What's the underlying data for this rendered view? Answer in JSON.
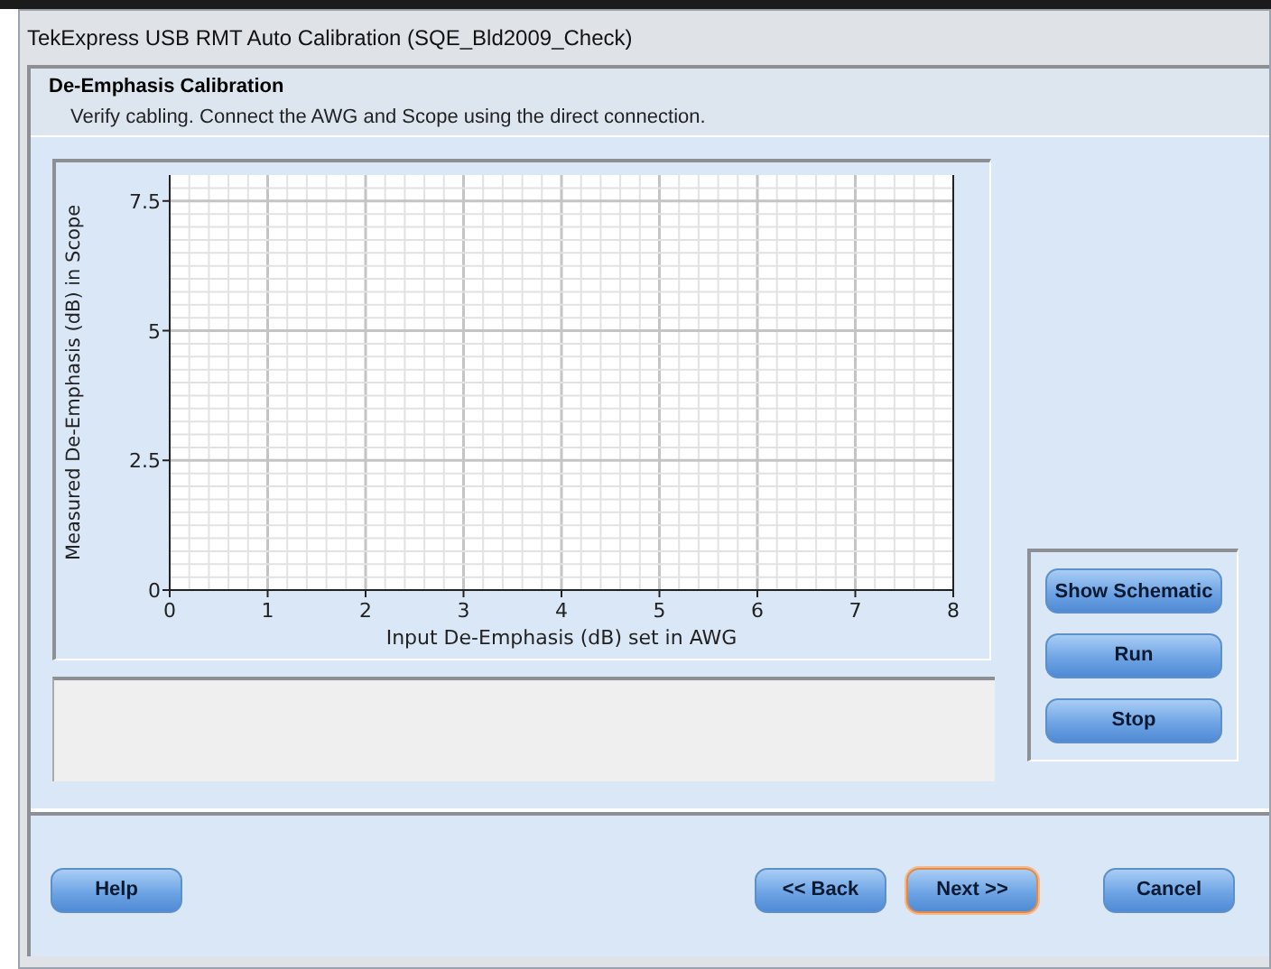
{
  "window": {
    "title": "TekExpress USB RMT Auto Calibration (SQE_Bld2009_Check)"
  },
  "header": {
    "title": "De-Emphasis Calibration",
    "instruction": "Verify cabling. Connect the AWG and Scope using the direct connection."
  },
  "chart": {
    "chart_data": {
      "type": "line",
      "xlabel": "Input De-Emphasis (dB) set in AWG",
      "ylabel": "Measured De-Emphasis (dB) in Scope",
      "xlim": [
        0,
        8
      ],
      "ylim": [
        0,
        8
      ],
      "grid": true,
      "xticks": [
        0,
        1,
        2,
        3,
        4,
        5,
        6,
        7,
        8
      ],
      "yticks": [
        {
          "value": 0,
          "label": "0"
        },
        {
          "value": 2.5,
          "label": "2.5"
        },
        {
          "value": 5,
          "label": "5"
        },
        {
          "value": 7.5,
          "label": "7.5"
        }
      ]
    }
  },
  "side_buttons": [
    {
      "label": "Show Schematic",
      "focused": false
    },
    {
      "label": "Run",
      "focused": false
    },
    {
      "label": "Stop",
      "focused": false
    }
  ],
  "footer": {
    "left_buttons": [
      {
        "label": "Help",
        "focused": false
      }
    ],
    "right_buttons": [
      {
        "label": "<< Back",
        "focused": false
      },
      {
        "label": "Next >>",
        "focused": true
      },
      {
        "label": "Cancel",
        "focused": false
      }
    ]
  }
}
